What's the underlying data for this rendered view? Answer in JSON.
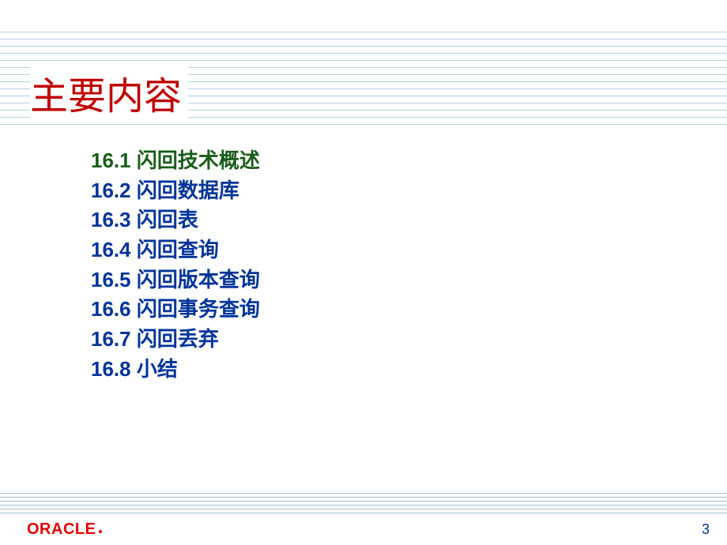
{
  "title": "主要内容",
  "toc": [
    {
      "num": "16.1",
      "text": "闪回技术概述",
      "highlight": true
    },
    {
      "num": "16.2",
      "text": "闪回数据库",
      "highlight": false
    },
    {
      "num": "16.3",
      "text": "闪回表",
      "highlight": false
    },
    {
      "num": "16.4",
      "text": "闪回查询",
      "highlight": false
    },
    {
      "num": "16.5",
      "text": "闪回版本查询",
      "highlight": false
    },
    {
      "num": "16.6",
      "text": "闪回事务查询",
      "highlight": false
    },
    {
      "num": "16.7",
      "text": "闪回丢弃",
      "highlight": false
    },
    {
      "num": "16.8",
      "text": "小结",
      "highlight": false
    }
  ],
  "footer": {
    "logo": "ORACLE",
    "page": "3"
  }
}
